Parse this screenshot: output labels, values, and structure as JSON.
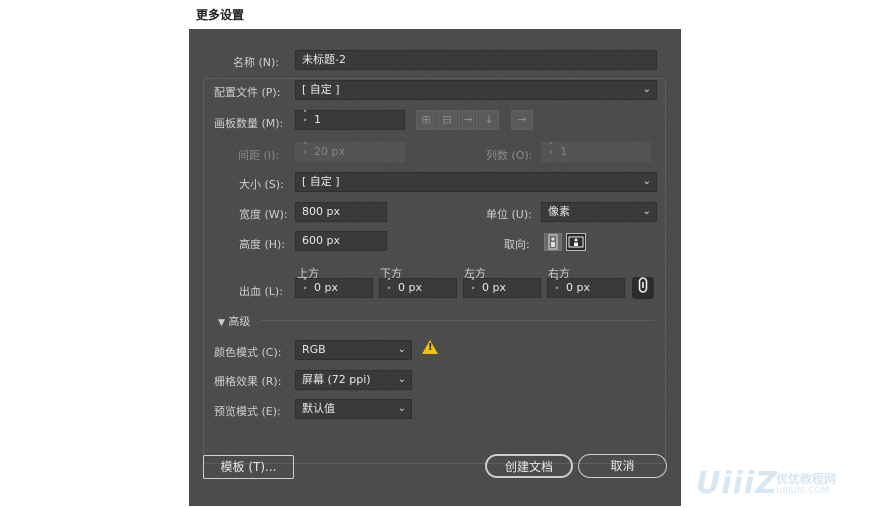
{
  "window_title": "更多设置",
  "name": {
    "label": "名称 (N):",
    "value": "未标题-2"
  },
  "profile": {
    "label": "配置文件 (P):",
    "value": "[ 自定 ]"
  },
  "artboards": {
    "label": "画板数量 (M):",
    "value": "1"
  },
  "spacing": {
    "label": "间距 (I):",
    "value": "20 px"
  },
  "columns": {
    "label": "列数 (O):",
    "value": "1"
  },
  "size": {
    "label": "大小 (S):",
    "value": "[ 自定 ]"
  },
  "width": {
    "label": "宽度 (W):",
    "value": "800 px"
  },
  "height": {
    "label": "高度 (H):",
    "value": "600 px"
  },
  "units": {
    "label": "单位 (U):",
    "value": "像素"
  },
  "orientation": {
    "label": "取向:"
  },
  "bleed": {
    "label": "出血 (L):",
    "top": {
      "label": "上方",
      "value": "0 px"
    },
    "bottom": {
      "label": "下方",
      "value": "0 px"
    },
    "left": {
      "label": "左方",
      "value": "0 px"
    },
    "right": {
      "label": "右方",
      "value": "0 px"
    }
  },
  "advanced": {
    "label": "高级"
  },
  "color_mode": {
    "label": "颜色模式 (C):",
    "value": "RGB"
  },
  "raster": {
    "label": "栅格效果 (R):",
    "value": "屏幕 (72 ppi)"
  },
  "preview": {
    "label": "预览模式 (E):",
    "value": "默认值"
  },
  "buttons": {
    "template": "模板 (T)...",
    "create": "创建文档",
    "cancel": "取消"
  },
  "watermark": {
    "brand": "UiiiZ",
    "cn": "优优教程网",
    "url": "UIIIUIII.COM"
  },
  "colors": {
    "dialog_bg": "#4a4a4a",
    "field_bg": "#3a3a3a",
    "warning": "#f2c200"
  }
}
